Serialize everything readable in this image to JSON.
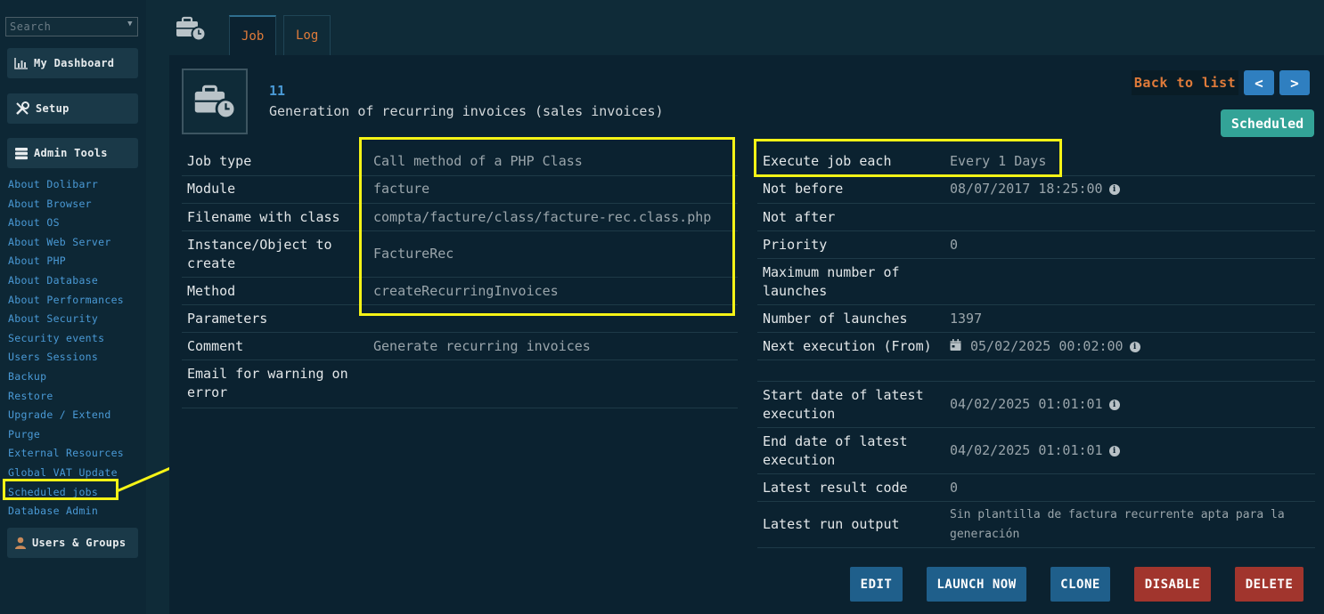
{
  "sidebar": {
    "search_placeholder": "Search",
    "blocks": {
      "dashboard": "My Dashboard",
      "setup": "Setup",
      "admin_tools": "Admin Tools",
      "users_groups": "Users & Groups"
    },
    "links": [
      "About Dolibarr",
      "About Browser",
      "About OS",
      "About Web Server",
      "About PHP",
      "About Database",
      "About Performances",
      "About Security",
      "Security events",
      "Users Sessions",
      "Backup",
      "Restore",
      "Upgrade / Extend",
      "Purge",
      "External Resources",
      "Global VAT Update",
      "Scheduled jobs",
      "Database Admin"
    ]
  },
  "tabs": {
    "job": "Job",
    "log": "Log"
  },
  "job": {
    "ref": "11",
    "label": "Generation of recurring invoices (sales invoices)",
    "status": "Scheduled",
    "back_label": "Back to list",
    "prev_icon": "chevron-left-icon",
    "next_icon": "chevron-right-icon"
  },
  "left_fields": {
    "job_type": {
      "label": "Job type",
      "value": "Call method of a PHP Class"
    },
    "module": {
      "label": "Module",
      "value": "facture"
    },
    "filename": {
      "label": "Filename with class",
      "value": "compta/facture/class/facture-rec.class.php"
    },
    "instance": {
      "label": "Instance/Object to create",
      "value": "FactureRec"
    },
    "method": {
      "label": "Method",
      "value": "createRecurringInvoices"
    },
    "parameters": {
      "label": "Parameters",
      "value": ""
    },
    "comment": {
      "label": "Comment",
      "value": "Generate recurring invoices"
    },
    "email": {
      "label": "Email for warning on error",
      "value": ""
    }
  },
  "right_fields": {
    "execute_each": {
      "label": "Execute job each",
      "value": "Every 1 Days"
    },
    "not_before": {
      "label": "Not before",
      "value": "08/07/2017 18:25:00"
    },
    "not_after": {
      "label": "Not after",
      "value": ""
    },
    "priority": {
      "label": "Priority",
      "value": "0"
    },
    "max_launches": {
      "label": "Maximum number of launches",
      "value": ""
    },
    "num_launches": {
      "label": "Number of launches",
      "value": "1397"
    },
    "next_exec": {
      "label": "Next execution (From)",
      "value": "05/02/2025 00:02:00"
    },
    "start_latest": {
      "label": "Start date of latest execution",
      "value": "04/02/2025 01:01:01"
    },
    "end_latest": {
      "label": "End date of latest execution",
      "value": "04/02/2025 01:01:01"
    },
    "result_code": {
      "label": "Latest result code",
      "value": "0"
    },
    "run_output": {
      "label": "Latest run output",
      "value": "Sin plantilla de factura recurrente apta para la generación"
    }
  },
  "actions": {
    "edit": "EDIT",
    "launch": "LAUNCH NOW",
    "clone": "CLONE",
    "disable": "DISABLE",
    "delete": "DELETE"
  },
  "colors": {
    "highlight": "#f5f316",
    "accent_orange": "#e07b3a",
    "link_blue": "#4a9ad6",
    "status_teal": "#33a397"
  }
}
